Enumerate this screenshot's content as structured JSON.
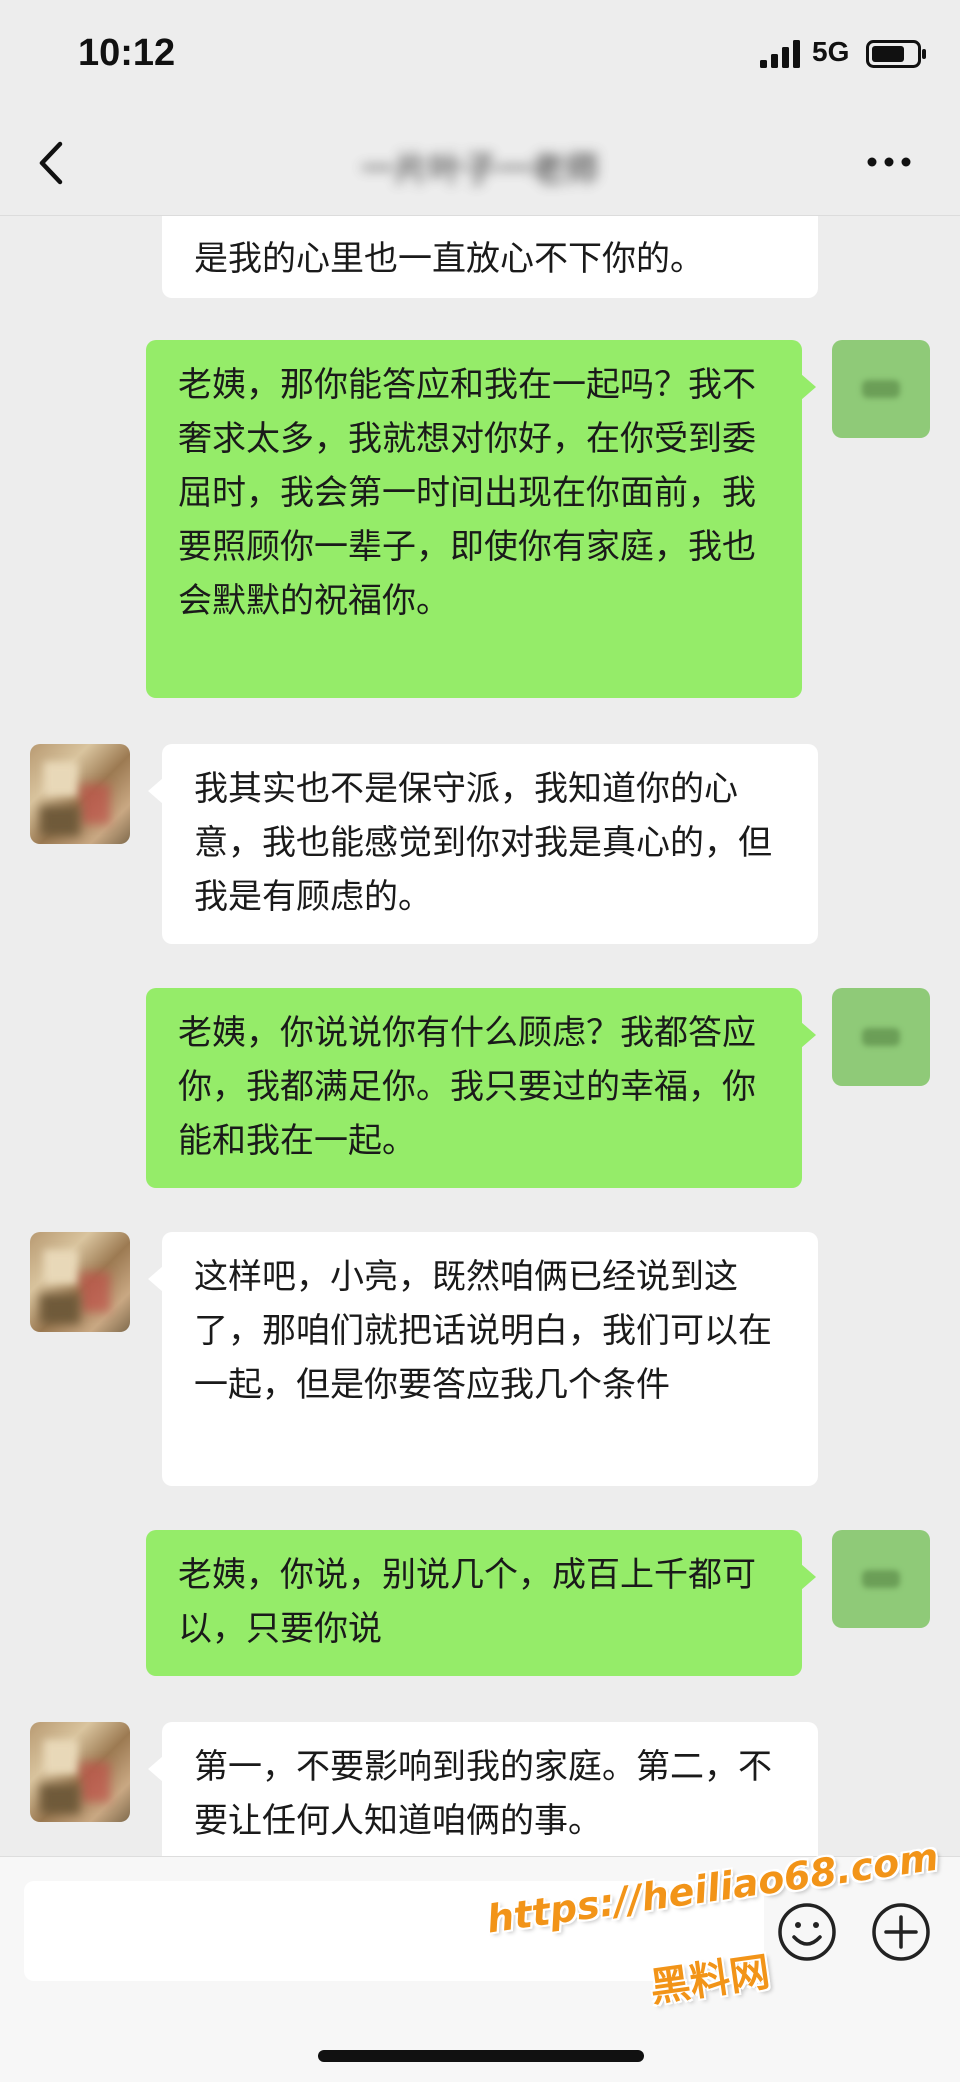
{
  "status_bar": {
    "time": "10:12",
    "network": "5G"
  },
  "header": {
    "title": "一片叶子一老师"
  },
  "messages": [
    {
      "from": "other",
      "text": "是我的心里也一直放心不下你的。"
    },
    {
      "from": "me",
      "text": "老姨，那你能答应和我在一起吗？我不奢求太多，我就想对你好，在你受到委屈时，我会第一时间出现在你面前，我要照顾你一辈子，即使你有家庭，我也会默默的祝福你。"
    },
    {
      "from": "other",
      "text": "我其实也不是保守派，我知道你的心意，我也能感觉到你对我是真心的，但我是有顾虑的。"
    },
    {
      "from": "me",
      "text": "老姨，你说说你有什么顾虑？我都答应你，我都满足你。我只要过的幸福，你能和我在一起。"
    },
    {
      "from": "other",
      "text": "这样吧，小亮，既然咱俩已经说到这了，那咱们就把话说明白，我们可以在一起，但是你要答应我几个条件"
    },
    {
      "from": "me",
      "text": "老姨，你说，别说几个，成百上千都可以，只要你说"
    },
    {
      "from": "other",
      "text": "第一，不要影响到我的家庭。第二，不要让任何人知道咱俩的事。"
    }
  ],
  "watermark": {
    "url": "https://heiliao68.com",
    "name": "黑料网"
  },
  "colors": {
    "background": "#ededed",
    "bubble_me": "#95ec69",
    "bubble_other": "#ffffff",
    "watermark": "#f29418"
  },
  "icons": [
    "back-icon",
    "more-icon",
    "signal-icon",
    "battery-icon",
    "emoji-icon",
    "plus-icon"
  ]
}
